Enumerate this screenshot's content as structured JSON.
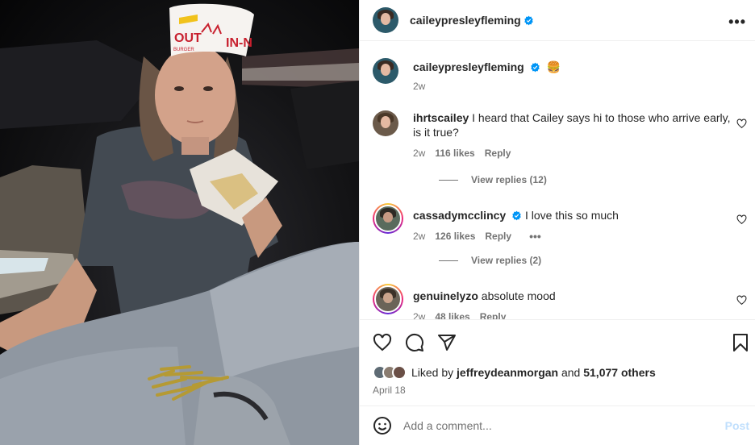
{
  "header": {
    "username": "caileypresleyfleming",
    "more_label": "•••"
  },
  "caption": {
    "username": "caileypresleyfleming",
    "emoji": "🍔",
    "time": "2w"
  },
  "photo": {
    "hat_text_left": "OUT",
    "hat_text_right": "IN-N",
    "hat_subtext": "BURGER"
  },
  "comments": [
    {
      "username": "ihrtscailey",
      "text": "I heard that Cailey says hi to those who arrive early, is it true?",
      "time": "2w",
      "likes": "116 likes",
      "reply_label": "Reply",
      "view_replies": "View replies (12)"
    },
    {
      "username": "cassadymcclincy",
      "text": "I love this so much",
      "time": "2w",
      "likes": "126 likes",
      "reply_label": "Reply",
      "options_label": "•••",
      "view_replies": "View replies (2)"
    },
    {
      "username": "genuinelyzo",
      "text": "absolute mood",
      "time": "2w",
      "likes": "48 likes",
      "reply_label": "Reply"
    }
  ],
  "likes": {
    "prefix": "Liked by",
    "user": "jeffreydeanmorgan",
    "and": "and",
    "others": "51,077 others"
  },
  "post_date": "April 18",
  "add_comment": {
    "placeholder": "Add a comment...",
    "post_label": "Post"
  },
  "colors": {
    "verified": "#0095f6",
    "post_disabled": "#c0dffd",
    "muted": "#737373"
  },
  "icons": [
    "heart-icon",
    "comment-icon",
    "share-icon",
    "bookmark-icon",
    "emoji-icon",
    "more-icon",
    "verified-icon"
  ]
}
